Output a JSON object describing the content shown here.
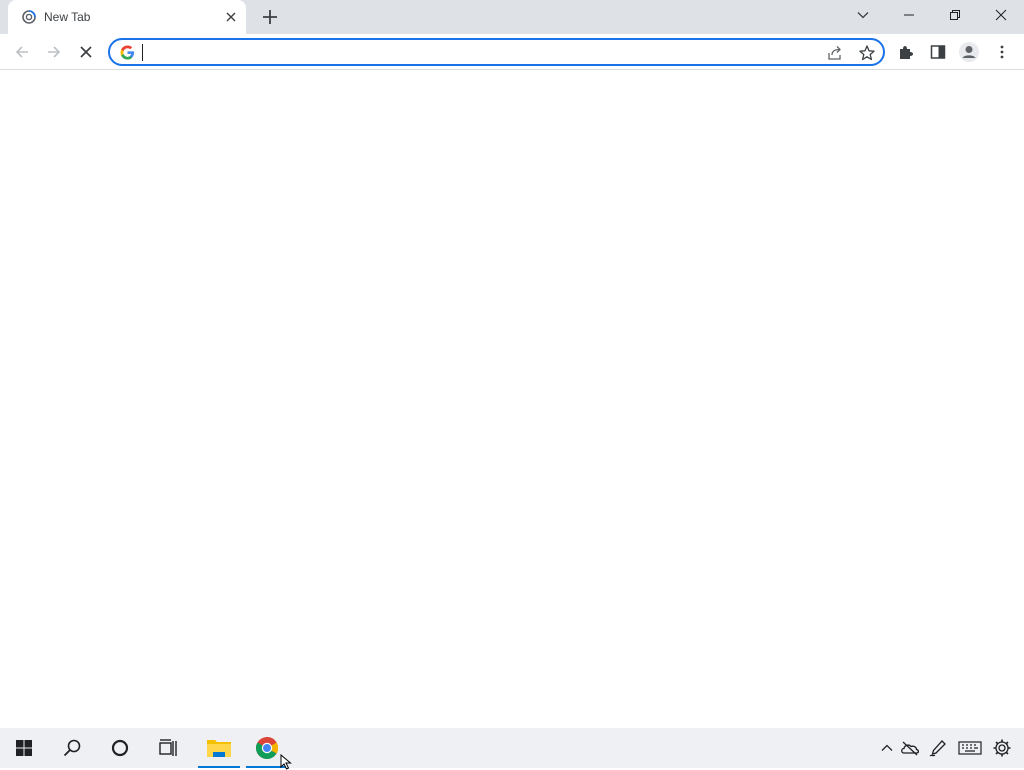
{
  "browser": {
    "tab": {
      "title": "New Tab"
    },
    "omnibox": {
      "value": "",
      "placeholder": ""
    }
  },
  "icons": {
    "tab_favicon": "chrome-loading-icon",
    "tab_close": "close-icon",
    "new_tab": "plus-icon",
    "tab_search": "chevron-down-icon",
    "minimize": "minimize-icon",
    "restore": "restore-icon",
    "close_window": "close-icon",
    "back": "arrow-left-icon",
    "forward": "arrow-right-icon",
    "stop": "stop-x-icon",
    "google": "google-g-icon",
    "share": "share-icon",
    "bookmark": "star-icon",
    "extensions": "puzzle-icon",
    "side_panel": "side-panel-icon",
    "profile": "profile-icon",
    "menu": "kebab-menu-icon"
  },
  "taskbar": {
    "items": [
      "start",
      "search",
      "cortana",
      "task-view",
      "file-explorer",
      "chrome"
    ],
    "tray": [
      "show-hidden-icons",
      "onedrive",
      "pen-workspace",
      "touch-keyboard",
      "settings"
    ]
  },
  "colors": {
    "accent": "#1a73e8",
    "tabstrip": "#dee1e6",
    "taskbar": "#eef0f3",
    "taskbar_active": "#0078d4"
  }
}
